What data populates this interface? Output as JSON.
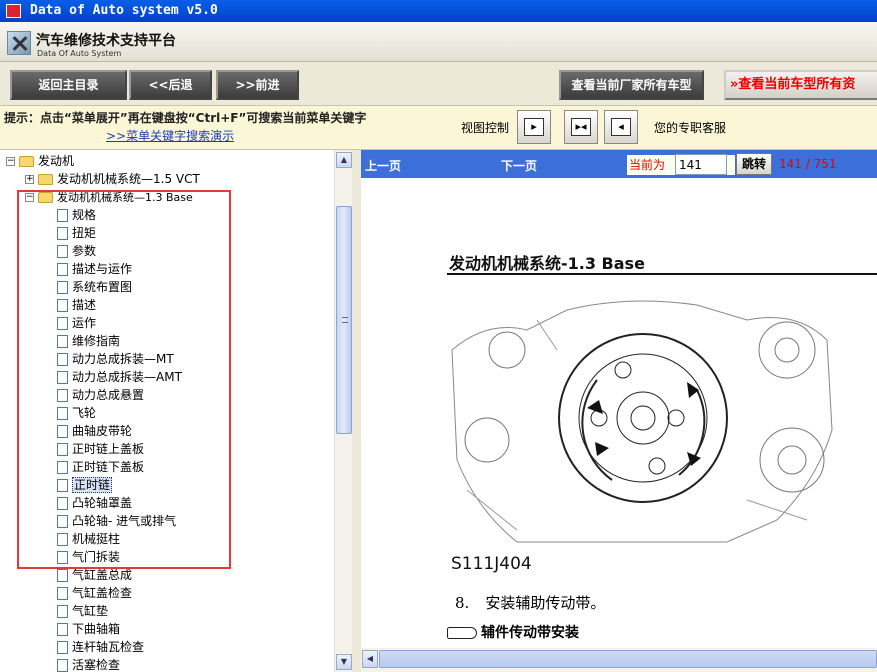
{
  "window": {
    "title": "Data of Auto system v5.0"
  },
  "brand": {
    "title": "汽车维修技术支持平台",
    "subtitle": "Data Of Auto System"
  },
  "toolbar": {
    "back_main": "返回主目录",
    "back": "<<后退",
    "forward": ">>前进",
    "view_all_maker_models": "查看当前厂家所有车型",
    "view_all_current_model": "查看当前车型所有资"
  },
  "hintbar": {
    "hint": "提示：点击“菜单展开”再在键盘按“Ctrl+F”可搜索当前菜单关键字",
    "search_demo_link": ">>菜单关键字搜索演示",
    "view_control_label": "视图控制",
    "support_text": "您的专职客服"
  },
  "tree": {
    "root": "发动机",
    "node_vct": "发动机机械系统—1.5 VCT",
    "node_base": "发动机机械系统—1.3 Base",
    "children": [
      "规格",
      "扭矩",
      "参数",
      "描述与运作",
      "系统布置图",
      "描述",
      "运作",
      "维修指南",
      "动力总成拆装—MT",
      "动力总成拆装—AMT",
      "动力总成悬置",
      "飞轮",
      "曲轴皮带轮",
      "正时链上盖板",
      "正时链下盖板",
      "正时链",
      "凸轮轴罩盖",
      "凸轮轴- 进气或排气",
      "机械挺柱",
      "气门拆装",
      "气缸盖总成",
      "气缸盖检查",
      "气缸垫",
      "下曲轴箱",
      "连杆轴瓦检查",
      "活塞检查"
    ],
    "selected_index": 15
  },
  "pager": {
    "prev": "上一页",
    "next": "下一页",
    "current_label": "当前为",
    "current_value": "141",
    "jump": "跳转",
    "count": "141 / 751"
  },
  "document": {
    "title": "发动机机械系统-1.3 Base",
    "figure_code": "S111J404",
    "step_number": "8.",
    "step_text": "安装辅助传动带。",
    "subheading": "辅件传动带安装"
  },
  "colors": {
    "highlight_box": "#e23a3a",
    "nav_bar": "#3c6fd9",
    "count_text": "#e00000"
  }
}
